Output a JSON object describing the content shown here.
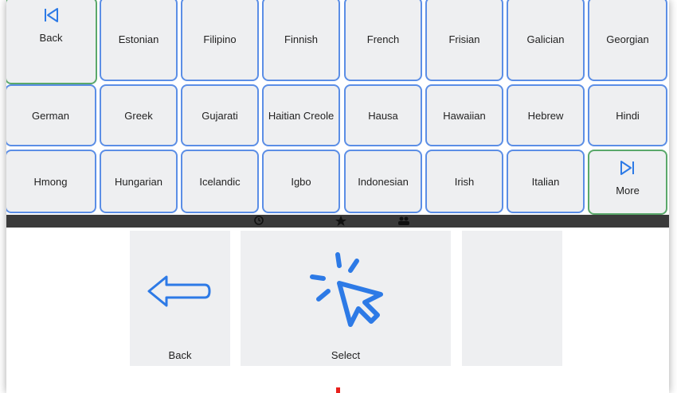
{
  "nav": {
    "back_label": "Back",
    "more_label": "More"
  },
  "languages": [
    "Estonian",
    "Filipino",
    "Finnish",
    "French",
    "Frisian",
    "Galician",
    "Georgian",
    "German",
    "Greek",
    "Gujarati",
    "Haitian Creole",
    "Hausa",
    "Hawaiian",
    "Hebrew",
    "Hindi",
    "Hmong",
    "Hungarian",
    "Icelandic",
    "Igbo",
    "Indonesian",
    "Irish",
    "Italian"
  ],
  "toolbar": {
    "icons": [
      "history-icon",
      "star-icon",
      "people-icon"
    ]
  },
  "controls": {
    "back_label": "Back",
    "select_label": "Select"
  },
  "colors": {
    "key_border": "#5b8ee6",
    "nav_border": "#5aa86a",
    "icon_blue": "#2d7ae6",
    "panel_bg": "#eeeff1"
  }
}
